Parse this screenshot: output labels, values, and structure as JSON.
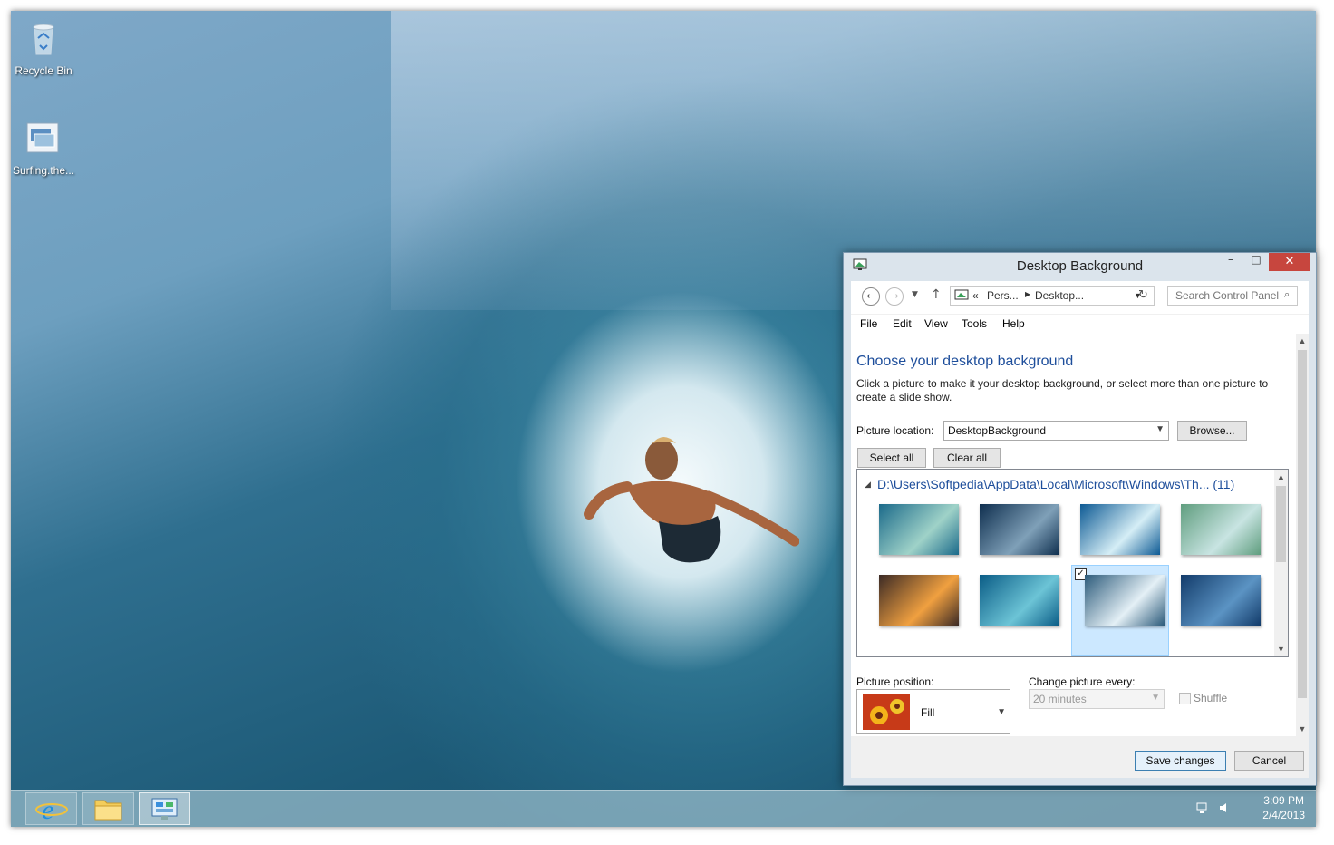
{
  "desktop": {
    "icons": [
      {
        "label": "Recycle Bin",
        "icon": "recycle-bin-icon"
      },
      {
        "label": "Surfing.the...",
        "icon": "theme-pack-icon"
      }
    ]
  },
  "window": {
    "title": "Desktop Background",
    "controls": {
      "minimize": "–",
      "maximize": "□",
      "close": "✕"
    },
    "address": {
      "chevron": "«",
      "crumbs": [
        "Pers...",
        "Desktop..."
      ]
    },
    "search_placeholder": "Search Control Panel",
    "menu": [
      "File",
      "Edit",
      "View",
      "Tools",
      "Help"
    ],
    "content": {
      "heading": "Choose your desktop background",
      "description": "Click a picture to make it your desktop background, or select more than one picture to create a slide show.",
      "picture_location_label": "Picture location:",
      "picture_location_value": "DesktopBackground",
      "browse_label": "Browse...",
      "select_all_label": "Select all",
      "clear_all_label": "Clear all",
      "folder_path": "D:\\Users\\Softpedia\\AppData\\Local\\Microsoft\\Windows\\Th... (11)",
      "thumbnails": [
        {
          "selected": false,
          "colors": [
            "#1b6a8a",
            "#9fd2c8"
          ]
        },
        {
          "selected": false,
          "colors": [
            "#0e2e4e",
            "#7fa0b8"
          ]
        },
        {
          "selected": false,
          "colors": [
            "#0d5a94",
            "#d5eef6"
          ]
        },
        {
          "selected": false,
          "colors": [
            "#5f9d7e",
            "#c8e4e2"
          ]
        },
        {
          "selected": false,
          "colors": [
            "#3b2a25",
            "#f0a040"
          ]
        },
        {
          "selected": false,
          "colors": [
            "#0a5c86",
            "#6cc4d6"
          ]
        },
        {
          "selected": true,
          "colors": [
            "#2c5b7b",
            "#e4f0f6"
          ]
        },
        {
          "selected": false,
          "colors": [
            "#123b6a",
            "#5b93c3"
          ]
        }
      ],
      "picture_position_label": "Picture position:",
      "picture_position_value": "Fill",
      "change_picture_label": "Change picture every:",
      "change_picture_value": "20 minutes",
      "shuffle_label": "Shuffle"
    },
    "footer": {
      "save_label": "Save changes",
      "cancel_label": "Cancel"
    }
  },
  "taskbar": {
    "apps": [
      {
        "name": "internet-explorer",
        "icon": "internet-explorer-icon"
      },
      {
        "name": "file-explorer",
        "icon": "folder-icon"
      },
      {
        "name": "control-panel",
        "icon": "control-panel-icon",
        "active": true
      }
    ],
    "clock": {
      "time": "3:09 PM",
      "date": "2/4/2013"
    }
  }
}
